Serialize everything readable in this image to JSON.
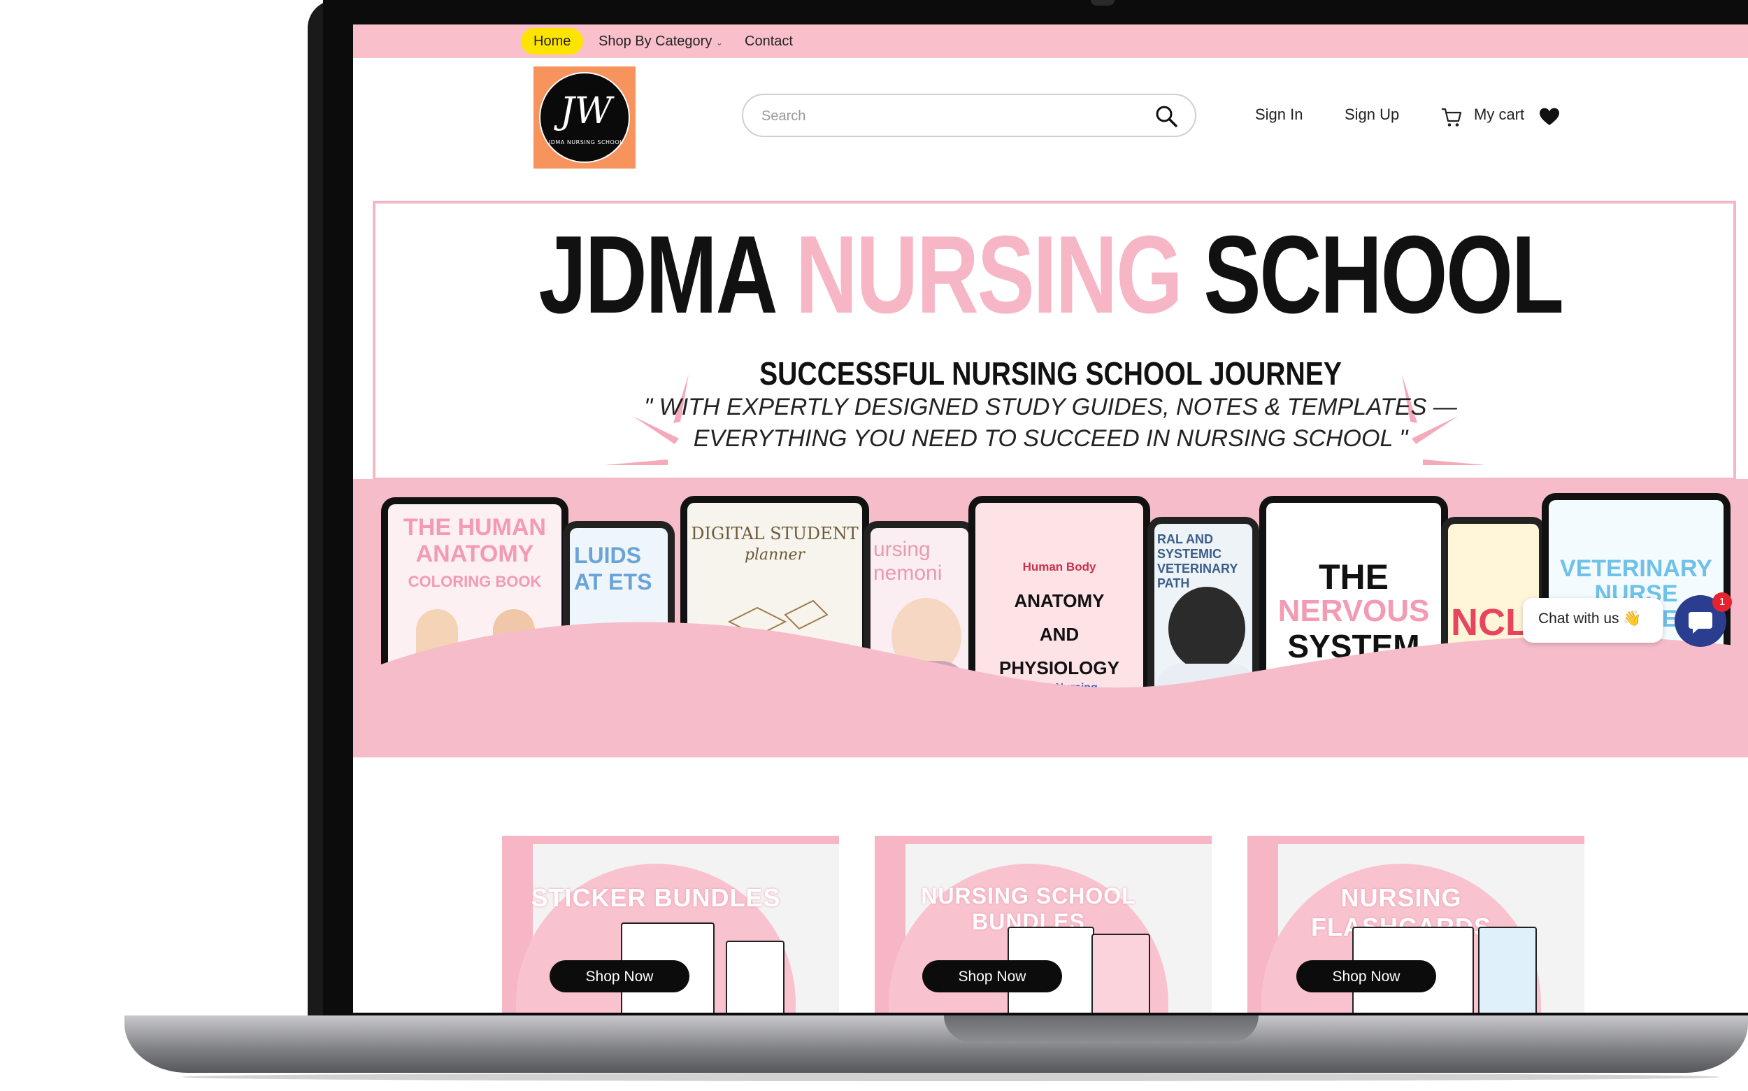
{
  "nav": {
    "home": "Home",
    "shop_by_category": "Shop By Category",
    "contact": "Contact"
  },
  "logo": {
    "monogram": "JW",
    "subtitle": "JDMA NURSING SCHOOL"
  },
  "header": {
    "search_placeholder": "Search",
    "sign_in": "Sign In",
    "sign_up": "Sign Up",
    "my_cart": "My cart"
  },
  "hero": {
    "title_part1": "JDMA ",
    "title_part2": "NURSING",
    "title_part3": " SCHOOL",
    "subtitle": "SUCCESSFUL NURSING SCHOOL JOURNEY",
    "quote_line1": "\" WITH EXPERTLY DESIGNED STUDY GUIDES, NOTES & TEMPLATES —",
    "quote_line2": "EVERYTHING YOU NEED TO SUCCEED IN NURSING SCHOOL \"",
    "tablets": {
      "t1": "THE HUMAN ANATOMY",
      "t1b": "COLORING BOOK",
      "t2": "LUIDS AT ETS",
      "t3": "DIGITAL STUDENT",
      "t3b": "planner",
      "t4": "ursing nemoni",
      "t5a": "Human Body",
      "t5b": "ANATOMY AND PHYSIOLOGY",
      "t5c": "JDMA Nursing School",
      "t6": "RAL AND SYSTEMIC VETERINARY PATH",
      "t7a": "THE",
      "t7b": "NERVOUS",
      "t7c": "SYSTEM",
      "t8": "NCL",
      "t9": "VETERINARY NURSE BUNDLES"
    }
  },
  "chat": {
    "label": "Chat with us 👋",
    "badge": "1"
  },
  "categories": [
    {
      "title": "STICKER BUNDLES",
      "button": "Shop Now"
    },
    {
      "title": "NURSING SCHOOL BUNDLES",
      "button": "Shop Now"
    },
    {
      "title": "NURSING FLASHCARDS",
      "button": "Shop Now"
    }
  ],
  "colors": {
    "topbar": "#f9c0cc",
    "home_highlight": "#fde400",
    "hero_pink": "#f6bcc9",
    "chat_button": "#2a3d8f"
  }
}
